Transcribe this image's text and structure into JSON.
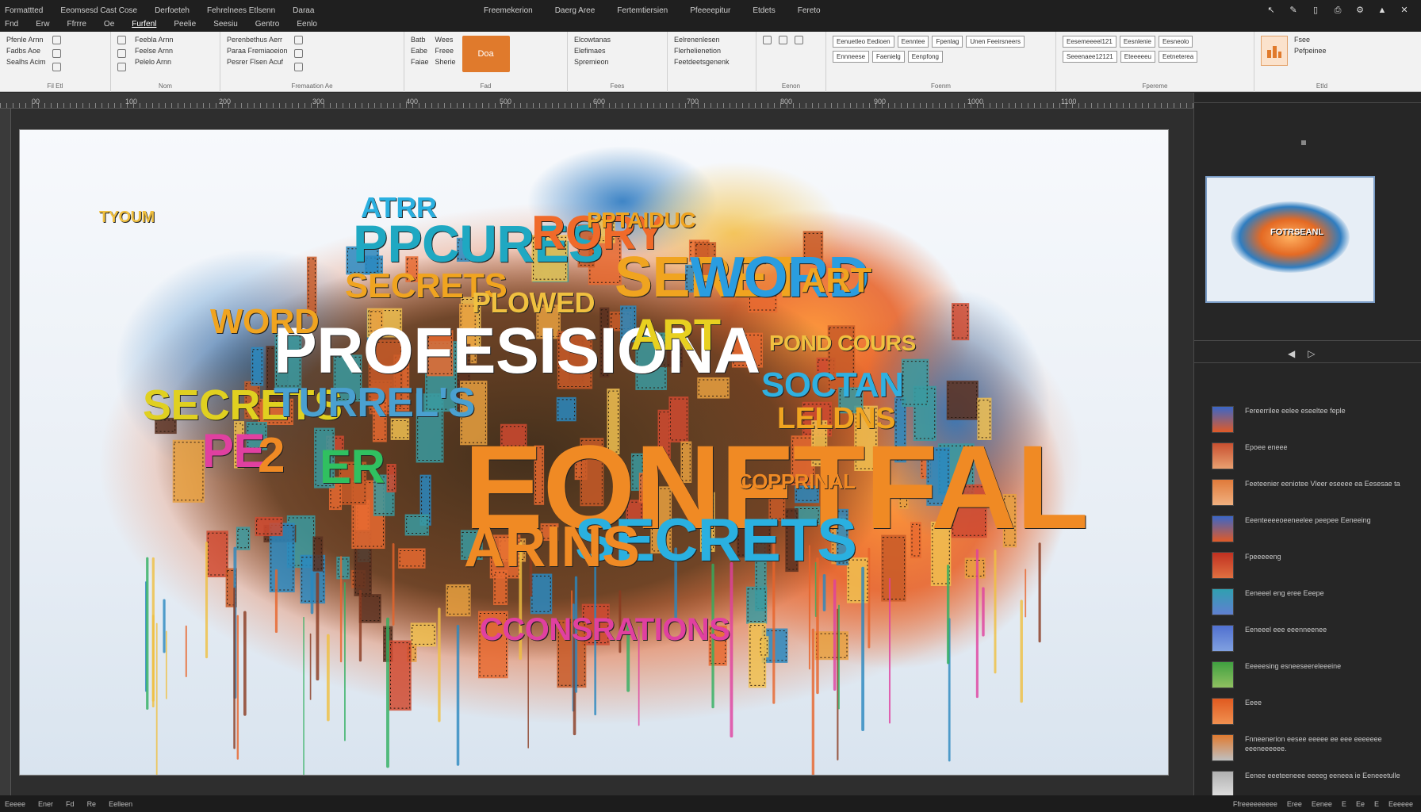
{
  "titlebar": {
    "left_items": [
      "Formattted",
      "Eeomsesd Cast Cose",
      "Derfoeteh",
      "Fehrelnees Etlsenn",
      "Daraa"
    ],
    "center_items": [
      "Freemekerion",
      "Daerg Aree",
      "Fertemtiersien",
      "Pfeeeepitur",
      "Etdets",
      "Fereto"
    ],
    "icons": [
      "back-icon",
      "draw-icon",
      "copy-icon",
      "print-icon",
      "settings-icon",
      "up-icon",
      "close-icon"
    ]
  },
  "menubar": [
    "Fnd",
    "Erw",
    "Ffrrre",
    "Oe",
    "Furfenl",
    "Peelie",
    "Seesiu",
    "Gentro",
    "Eenlo"
  ],
  "ribbon": {
    "group1": {
      "items": [
        "Pfenle Arnn",
        "Fadbs Aoe",
        "Sealhs Acim"
      ],
      "label": "Fil Etl"
    },
    "group2": {
      "items": [
        "Feebla Arnn",
        "Feelse Arnn",
        "Pelelo Arnn"
      ],
      "label": "Nom"
    },
    "group3": {
      "items": [
        "Perenbethus Aerr",
        "Paraa Fremiaoeion",
        "Pesrer Flsen Acuf"
      ],
      "label": "Fremaation Ae"
    },
    "group4": {
      "items": [
        "Batb",
        "Eabe",
        "Faiae"
      ],
      "items2": [
        "Wees",
        "Freee",
        "Sherie"
      ],
      "big_button": "Doa",
      "label": "Fad"
    },
    "group5": {
      "items": [
        "Elcowtanas",
        "Elefimaes",
        "Spremieon"
      ],
      "label": "Fees"
    },
    "group6": {
      "items": [
        "Eelrenenlesen",
        "Flerhelienetion",
        "Feetdeetsgenenk"
      ],
      "label": ""
    },
    "group7": {
      "label": "Eenon"
    },
    "group8": {
      "boxes": [
        "Eenuetleo Eedioen",
        "Unen Feeirsneers",
        "Eenntee",
        "Ennneese",
        "Fpenlag",
        "Faenielg",
        "Eenpfong"
      ],
      "label": "Foenm"
    },
    "group9": {
      "boxes": [
        "Eesemeeeel121",
        "Seeenaee12121",
        "Eesnlenie",
        "Eteeeeeu",
        "Eesneolo",
        "Eetneterea"
      ],
      "label": "Fpereme"
    },
    "group10": {
      "items": [
        "Fsee",
        "Pefpeinee"
      ],
      "label": "EtId"
    }
  },
  "ruler": [
    "00",
    "100",
    "200",
    "300",
    "400",
    "500",
    "600",
    "700",
    "800",
    "900",
    "1000",
    "1100"
  ],
  "slide_words": [
    {
      "text": "PROFESISIONA",
      "color": "#ffffff"
    },
    {
      "text": "EONFTFAL",
      "color": "#f08a24"
    },
    {
      "text": "PPCURES",
      "color": "#1fa8c2"
    },
    {
      "text": "SECRETS",
      "color": "#f0a420"
    },
    {
      "text": "SERET",
      "color": "#f0a420"
    },
    {
      "text": "WORD",
      "color": "#2a9de0"
    },
    {
      "text": "ART",
      "color": "#f0a420"
    },
    {
      "text": "ART",
      "color": "#e8d020"
    },
    {
      "text": "WORD",
      "color": "#f0a420"
    },
    {
      "text": "SECRETS",
      "color": "#e0d020"
    },
    {
      "text": "TURREL'S",
      "color": "#4aa0d0"
    },
    {
      "text": "SECRETS",
      "color": "#2ab0e0"
    },
    {
      "text": "ARINS",
      "color": "#f08a24"
    },
    {
      "text": "CCONSRATIONS",
      "color": "#e040a0"
    },
    {
      "text": "PLOWED",
      "color": "#f0c040"
    },
    {
      "text": "RORY",
      "color": "#f06a2a"
    },
    {
      "text": "PPTAIDUC",
      "color": "#f0a420"
    },
    {
      "text": "SOCTAN",
      "color": "#30b0e0"
    },
    {
      "text": "COPPRINAL",
      "color": "#f08a24"
    },
    {
      "text": "PE",
      "color": "#e040a0"
    },
    {
      "text": "2",
      "color": "#f08a24"
    },
    {
      "text": "ER",
      "color": "#30c060"
    },
    {
      "text": "ATRR",
      "color": "#2ab0e0"
    },
    {
      "text": "POND COURS",
      "color": "#f0c040"
    },
    {
      "text": "LELDNS",
      "color": "#f0a420"
    },
    {
      "text": "TYOUM",
      "color": "#f0c040"
    }
  ],
  "right_panel": {
    "thumb_text": "FOTRSEANL",
    "styles": [
      {
        "text": "Fereerrilee eelee eseeltee feple",
        "colors": [
          "#3a66c8",
          "#e05a28"
        ]
      },
      {
        "text": "Epoee eneee",
        "colors": [
          "#c85030",
          "#e8a070"
        ]
      },
      {
        "text": "Feeteenier eeniotee Vleer eseeee ea Eesesae ta",
        "colors": [
          "#e07a3a",
          "#f0b080"
        ]
      },
      {
        "text": "Eeenteeeeoeeneelee peepee Eeneeing",
        "colors": [
          "#3a66c8",
          "#e05a28"
        ]
      },
      {
        "text": "Fpeeeeeng",
        "colors": [
          "#c03020",
          "#e07040"
        ]
      },
      {
        "text": "Eeneeel eng eree Eeepe",
        "colors": [
          "#30a0b0",
          "#6080d0"
        ]
      },
      {
        "text": "Eeneeel eee eeenneenee",
        "colors": [
          "#5070d0",
          "#80a0e0"
        ]
      },
      {
        "text": "Eeeeesing esneeseereleeeine",
        "colors": [
          "#40a040",
          "#90c060"
        ]
      },
      {
        "text": "Eeee",
        "colors": [
          "#e05a20",
          "#f09050"
        ]
      },
      {
        "text": "Fnneenerion eesee eeeee ee eee eeeeeee eeeneeeeee.",
        "colors": [
          "#e07a30",
          "#c0c0c0"
        ]
      },
      {
        "text": "Eenee eeeteeneee eeeeg eeneea ie Eeneeetulle",
        "colors": [
          "#b0b0b0",
          "#e0e0e0"
        ]
      }
    ]
  },
  "statusbar": {
    "left": [
      "Eeeee",
      "Ener",
      "Fd",
      "Re",
      "Eelleen"
    ],
    "right": [
      "Ffreeeeeeeee",
      "Eree",
      "Eenee",
      "E",
      "Ee",
      "E",
      "Eeeeee"
    ]
  }
}
